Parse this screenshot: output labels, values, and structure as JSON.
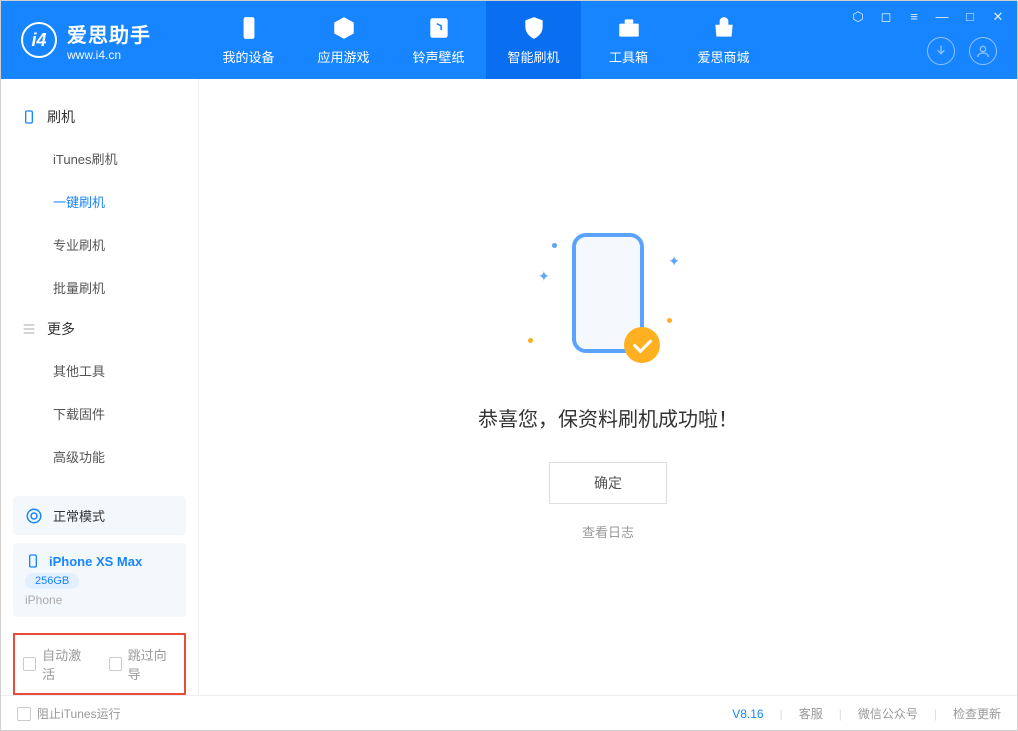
{
  "app": {
    "title": "爱思助手",
    "subtitle": "www.i4.cn"
  },
  "nav": {
    "tabs": [
      {
        "label": "我的设备"
      },
      {
        "label": "应用游戏"
      },
      {
        "label": "铃声壁纸"
      },
      {
        "label": "智能刷机"
      },
      {
        "label": "工具箱"
      },
      {
        "label": "爱思商城"
      }
    ]
  },
  "sidebar": {
    "group1": {
      "label": "刷机"
    },
    "items1": [
      {
        "label": "iTunes刷机"
      },
      {
        "label": "一键刷机"
      },
      {
        "label": "专业刷机"
      },
      {
        "label": "批量刷机"
      }
    ],
    "group2": {
      "label": "更多"
    },
    "items2": [
      {
        "label": "其他工具"
      },
      {
        "label": "下载固件"
      },
      {
        "label": "高级功能"
      }
    ]
  },
  "device": {
    "mode": "正常模式",
    "name": "iPhone XS Max",
    "storage": "256GB",
    "type": "iPhone"
  },
  "options": {
    "auto_activate": "自动激活",
    "skip_guide": "跳过向导"
  },
  "main": {
    "success": "恭喜您，保资料刷机成功啦！",
    "ok": "确定",
    "log": "查看日志"
  },
  "footer": {
    "block_itunes": "阻止iTunes运行",
    "version": "V8.16",
    "support": "客服",
    "wechat": "微信公众号",
    "update": "检查更新"
  }
}
